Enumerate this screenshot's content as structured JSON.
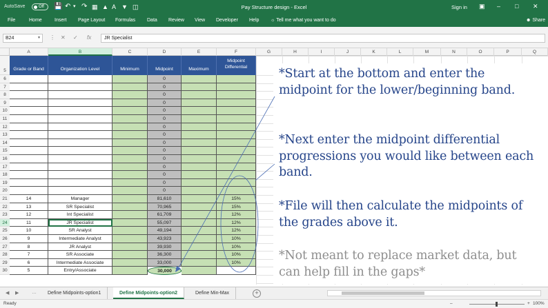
{
  "window": {
    "autosave_label": "AutoSave",
    "autosave_state": "Off",
    "title": "Pay Structure design  -  Excel",
    "signin": "Sign in"
  },
  "menu": [
    "File",
    "Home",
    "Insert",
    "Page Layout",
    "Formulas",
    "Data",
    "Review",
    "View",
    "Developer",
    "Help"
  ],
  "tell_me": "Tell me what you want to do",
  "share": "Share",
  "formula_bar": {
    "name_box": "B24",
    "formula": "JR Specialist"
  },
  "columns": [
    "A",
    "B",
    "C",
    "D",
    "E",
    "F",
    "G",
    "H",
    "I",
    "J",
    "K",
    "L",
    "M",
    "N",
    "O",
    "P",
    "Q"
  ],
  "table": {
    "headers": {
      "grade": "Grade or Band",
      "level": "Organization Level",
      "minimum": "Minimum",
      "midpoint": "Midpoint",
      "maximum": "Maximum",
      "diff_line1": "Midpoint",
      "diff_line2": "Differential"
    },
    "rows": [
      {
        "row": "6",
        "grade": "",
        "level": "",
        "midpoint": "0",
        "diff": ""
      },
      {
        "row": "7",
        "grade": "",
        "level": "",
        "midpoint": "0",
        "diff": ""
      },
      {
        "row": "8",
        "grade": "",
        "level": "",
        "midpoint": "0",
        "diff": ""
      },
      {
        "row": "9",
        "grade": "",
        "level": "",
        "midpoint": "0",
        "diff": ""
      },
      {
        "row": "10",
        "grade": "",
        "level": "",
        "midpoint": "0",
        "diff": ""
      },
      {
        "row": "11",
        "grade": "",
        "level": "",
        "midpoint": "0",
        "diff": ""
      },
      {
        "row": "12",
        "grade": "",
        "level": "",
        "midpoint": "0",
        "diff": ""
      },
      {
        "row": "13",
        "grade": "",
        "level": "",
        "midpoint": "0",
        "diff": ""
      },
      {
        "row": "14",
        "grade": "",
        "level": "",
        "midpoint": "0",
        "diff": ""
      },
      {
        "row": "15",
        "grade": "",
        "level": "",
        "midpoint": "0",
        "diff": ""
      },
      {
        "row": "16",
        "grade": "",
        "level": "",
        "midpoint": "0",
        "diff": ""
      },
      {
        "row": "17",
        "grade": "",
        "level": "",
        "midpoint": "0",
        "diff": ""
      },
      {
        "row": "18",
        "grade": "",
        "level": "",
        "midpoint": "0",
        "diff": ""
      },
      {
        "row": "19",
        "grade": "",
        "level": "",
        "midpoint": "0",
        "diff": ""
      },
      {
        "row": "20",
        "grade": "",
        "level": "",
        "midpoint": "0",
        "diff": ""
      },
      {
        "row": "21",
        "grade": "14",
        "level": "Manager",
        "midpoint": "81,610",
        "diff": "15%"
      },
      {
        "row": "22",
        "grade": "13",
        "level": "SR Specialist",
        "midpoint": "70,965",
        "diff": "15%"
      },
      {
        "row": "23",
        "grade": "12",
        "level": "Int Specialist",
        "midpoint": "61,709",
        "diff": "12%"
      },
      {
        "row": "24",
        "grade": "11",
        "level": "JR Specialist",
        "midpoint": "55,097",
        "diff": "12%"
      },
      {
        "row": "25",
        "grade": "10",
        "level": "SR Analyst",
        "midpoint": "49,194",
        "diff": "12%"
      },
      {
        "row": "26",
        "grade": "9",
        "level": "Intermediate Analyst",
        "midpoint": "43,923",
        "diff": "10%"
      },
      {
        "row": "27",
        "grade": "8",
        "level": "JR Analyst",
        "midpoint": "39,930",
        "diff": "10%"
      },
      {
        "row": "28",
        "grade": "7",
        "level": "SR Associate",
        "midpoint": "36,300",
        "diff": "10%"
      },
      {
        "row": "29",
        "grade": "6",
        "level": "Intermediate Associate",
        "midpoint": "33,000",
        "diff": "10%"
      },
      {
        "row": "30",
        "grade": "5",
        "level": "Entry/Associate",
        "midpoint": "30,000",
        "diff": ""
      }
    ]
  },
  "annotations": [
    "*Start at the bottom and enter the midpoint for the lower/beginning band.",
    "*Next enter the midpoint differential progressions you would like between each band.",
    "*File will then calculate the midpoints of the grades above it.",
    "*Not meant to replace market data, but can help fill in the gaps*"
  ],
  "sheets": [
    "Define Midpoints-option1",
    "Define Midpoints-option2",
    "Define Min-Max"
  ],
  "active_sheet": "Define Midpoints-option2",
  "status": {
    "ready": "Ready",
    "zoom": "100%"
  },
  "colors": {
    "excel_green": "#217346",
    "header_blue": "#2e5597",
    "fill_green": "#c6e0b4",
    "fill_gray": "#bfbfbf",
    "note_blue": "#26458a",
    "note_gray": "#8e8e8e"
  }
}
